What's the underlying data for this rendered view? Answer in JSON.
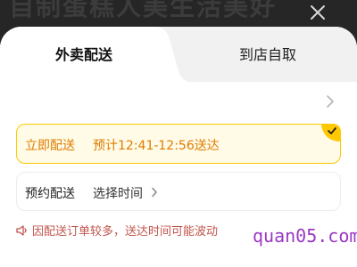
{
  "backdrop": {
    "text": "自制蛋糕人美生活美好"
  },
  "tabs": [
    {
      "label": "外卖配送",
      "active": true
    },
    {
      "label": "到店自取",
      "active": false
    }
  ],
  "options": {
    "now": {
      "label": "立即配送",
      "eta": "预计12:41-12:56送达",
      "selected": true
    },
    "reserve": {
      "label": "预约配送",
      "time_label": "选择时间"
    }
  },
  "notice": {
    "text": "因配送订单较多，送达时间可能波动"
  },
  "watermark": {
    "text": "quan05.com"
  },
  "colors": {
    "accent": "#ffc800",
    "accent_text": "#e07b00",
    "selected_bg": "#fffbe6",
    "notice_text": "#c1554c",
    "tab_bar_bg": "#f1f1f1",
    "overlay": "#262626",
    "watermark": "#9b39c4"
  },
  "icons": {
    "close": "close-icon",
    "chevron": "chevron-right-icon",
    "check": "checkmark-icon",
    "notice": "speaker-icon"
  }
}
